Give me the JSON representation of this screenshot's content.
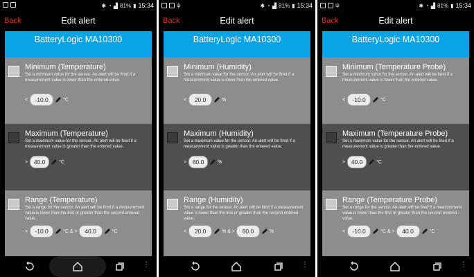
{
  "status": {
    "battery": "81%",
    "time": "15:34"
  },
  "header": {
    "back_label": "Back",
    "title": "Edit alert"
  },
  "device_name": "BatteryLogic MA10300",
  "phones": [
    {
      "minimum": {
        "title": "Minimum (Temperature)",
        "op": "<",
        "value": "-10.0",
        "unit": "°C"
      },
      "maximum": {
        "title": "Maximum (Temperature)",
        "op": ">",
        "value": "40.0",
        "unit": "°C"
      },
      "range": {
        "title": "Range (Temperature)",
        "op": "<",
        "value1": "-10.0",
        "sep": "°C & >",
        "value2": "40.0",
        "unit": "°C"
      }
    },
    {
      "minimum": {
        "title": "Minimum (Humidity)",
        "op": "<",
        "value": "20.0",
        "unit": "%"
      },
      "maximum": {
        "title": "Maximum (Humidity)",
        "op": ">",
        "value": "60.0",
        "unit": "%"
      },
      "range": {
        "title": "Range (Humidity)",
        "op": "<",
        "value1": "20.0",
        "sep": "% & >",
        "value2": "60.0",
        "unit": "%"
      }
    },
    {
      "minimum": {
        "title": "Minimum (Temperature Probe)",
        "op": "<",
        "value": "-10.0",
        "unit": "°C"
      },
      "maximum": {
        "title": "Maximum (Temperature Probe)",
        "op": ">",
        "value": "40.0",
        "unit": "°C"
      },
      "range": {
        "title": "Range (Temperature Probe)",
        "op": "<",
        "value1": "-10.0",
        "sep": "°C & >",
        "value2": "40.0",
        "unit": "°C"
      }
    }
  ],
  "descriptions": {
    "minimum": "Set a minimum value for the sensor. An alert will be fired if a measurement value is lower than the entered value.",
    "maximum": "Set a maximum value for the sensor. An alert will be fired if a measurement value is greater than the entered value.",
    "range": "Set a range for the sensor. An alert will be fired if a measurement value is lower than the first or greater than the second entered value."
  },
  "colors": {
    "accent_blue": "#0aa4e6",
    "back_red": "#e2301a"
  },
  "icons": [
    "bluetooth-icon",
    "wifi-icon",
    "signal-icon",
    "battery-icon",
    "pencil-icon",
    "back-nav-icon",
    "home-nav-icon",
    "recents-nav-icon",
    "more-icon"
  ]
}
